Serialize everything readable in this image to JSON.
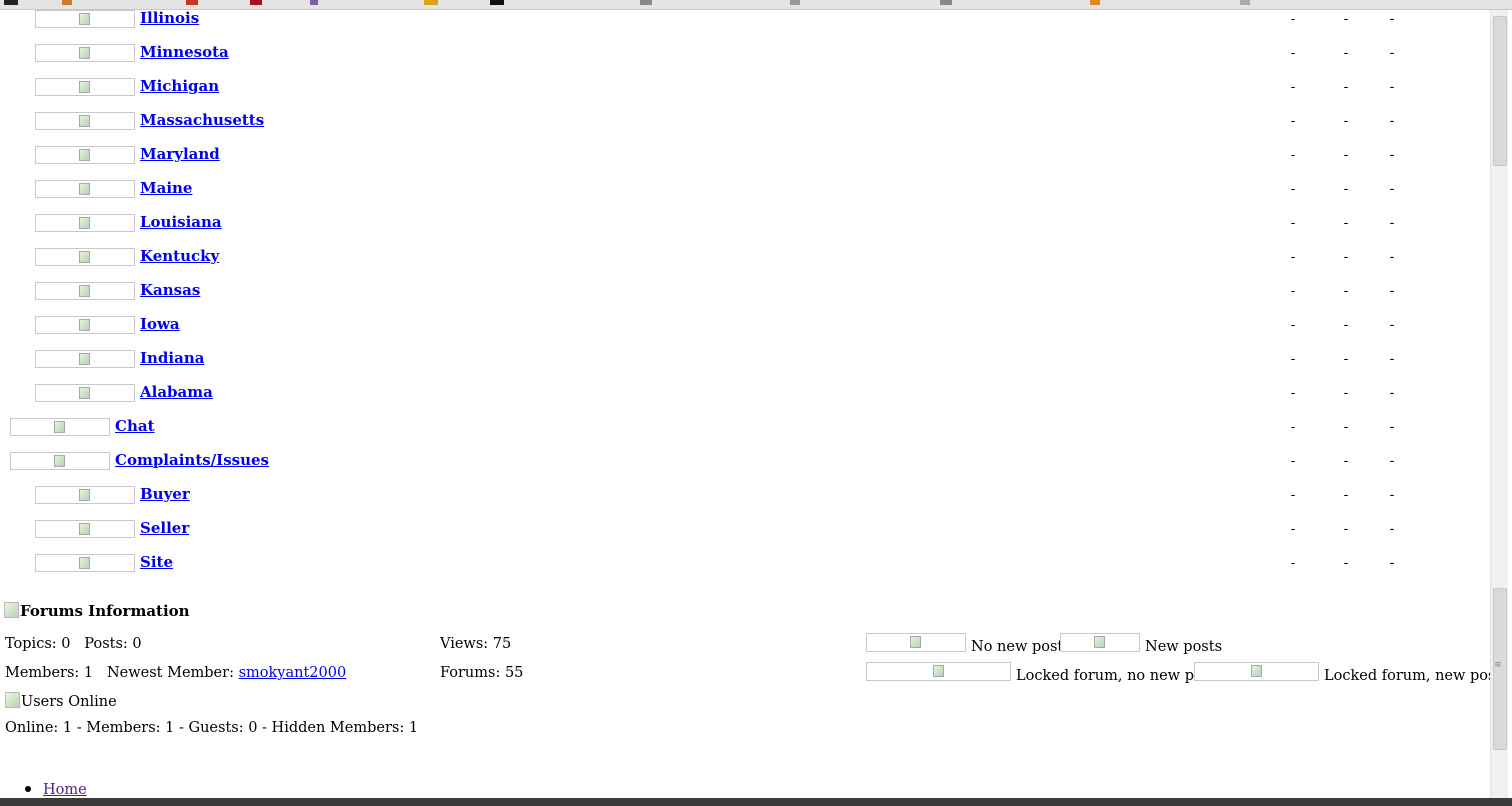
{
  "forums": [
    {
      "name": "Illinois",
      "level": 2,
      "topics": "-",
      "posts": "-",
      "last": "-"
    },
    {
      "name": "Minnesota",
      "level": 2,
      "topics": "-",
      "posts": "-",
      "last": "-"
    },
    {
      "name": "Michigan",
      "level": 2,
      "topics": "-",
      "posts": "-",
      "last": "-"
    },
    {
      "name": "Massachusetts",
      "level": 2,
      "topics": "-",
      "posts": "-",
      "last": "-"
    },
    {
      "name": "Maryland",
      "level": 2,
      "topics": "-",
      "posts": "-",
      "last": "-"
    },
    {
      "name": "Maine",
      "level": 2,
      "topics": "-",
      "posts": "-",
      "last": "-"
    },
    {
      "name": "Louisiana",
      "level": 2,
      "topics": "-",
      "posts": "-",
      "last": "-"
    },
    {
      "name": "Kentucky",
      "level": 2,
      "topics": "-",
      "posts": "-",
      "last": "-"
    },
    {
      "name": "Kansas",
      "level": 2,
      "topics": "-",
      "posts": "-",
      "last": "-"
    },
    {
      "name": "Iowa",
      "level": 2,
      "topics": "-",
      "posts": "-",
      "last": "-"
    },
    {
      "name": "Indiana",
      "level": 2,
      "topics": "-",
      "posts": "-",
      "last": "-"
    },
    {
      "name": "Alabama",
      "level": 2,
      "topics": "-",
      "posts": "-",
      "last": "-"
    },
    {
      "name": "Chat",
      "level": 1,
      "topics": "-",
      "posts": "-",
      "last": "-"
    },
    {
      "name": "Complaints/Issues",
      "level": 1,
      "topics": "-",
      "posts": "-",
      "last": "-"
    },
    {
      "name": "Buyer",
      "level": 2,
      "topics": "-",
      "posts": "-",
      "last": "-"
    },
    {
      "name": "Seller",
      "level": 2,
      "topics": "-",
      "posts": "-",
      "last": "-"
    },
    {
      "name": "Site",
      "level": 2,
      "topics": "-",
      "posts": "-",
      "last": "-"
    }
  ],
  "info": {
    "title": "Forums Information",
    "topics_posts": "Topics: 0   Posts: 0",
    "members_label": "Members: 1   Newest Member: ",
    "newest_member": "smokyant2000",
    "views": "Views: 75",
    "forums": "Forums: 55",
    "legend_no_new": "No new posts",
    "legend_new": "New posts",
    "legend_locked_no_new": "Locked forum, no new posts",
    "legend_locked_new": "Locked forum, new posts"
  },
  "users_online": {
    "title": "Users Online",
    "stats": "Online: 1 - Members: 1 - Guests: 0 - Hidden Members: 1"
  },
  "footer": {
    "home": "Home"
  }
}
